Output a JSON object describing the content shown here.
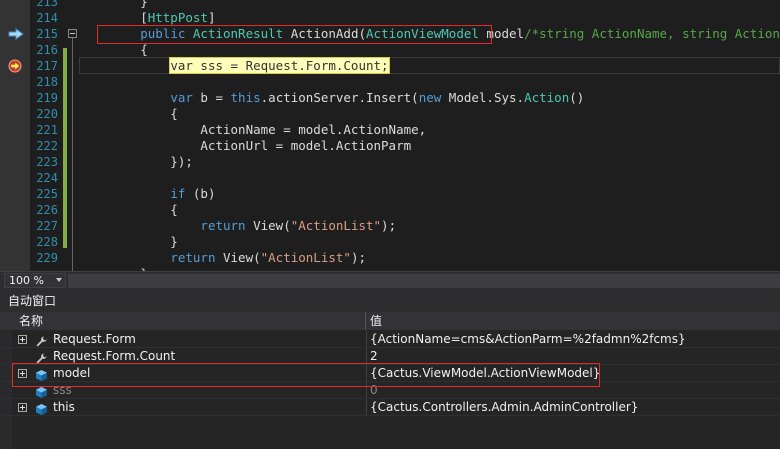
{
  "editor": {
    "lines": [
      {
        "num": "213",
        "segments": [
          {
            "t": "        }",
            "c": ""
          }
        ]
      },
      {
        "num": "214",
        "segments": [
          {
            "t": "        [",
            "c": ""
          },
          {
            "t": "HttpPost",
            "c": "ty"
          },
          {
            "t": "]",
            "c": ""
          }
        ]
      },
      {
        "num": "215",
        "segments": [
          {
            "t": "        ",
            "c": ""
          },
          {
            "t": "public ",
            "c": "kw"
          },
          {
            "t": "ActionResult",
            "c": "ty"
          },
          {
            "t": " ActionAdd(",
            "c": ""
          },
          {
            "t": "ActionViewModel",
            "c": "ty"
          },
          {
            "t": " model",
            "c": ""
          },
          {
            "t": "/*string ActionName, string ActionParm*/)",
            "c": "cm"
          }
        ]
      },
      {
        "num": "216",
        "segments": [
          {
            "t": "        {",
            "c": ""
          }
        ]
      },
      {
        "num": "217",
        "segments": [
          {
            "t": "            ",
            "c": ""
          },
          {
            "t": "var sss = Request.Form.Count;",
            "c": "exec-hl"
          }
        ]
      },
      {
        "num": "218",
        "segments": [
          {
            "t": "",
            "c": ""
          }
        ]
      },
      {
        "num": "219",
        "segments": [
          {
            "t": "            ",
            "c": ""
          },
          {
            "t": "var",
            "c": "kw"
          },
          {
            "t": " b = ",
            "c": ""
          },
          {
            "t": "this",
            "c": "kw"
          },
          {
            "t": ".actionServer.Insert(",
            "c": ""
          },
          {
            "t": "new",
            "c": "kw"
          },
          {
            "t": " Model.Sys.",
            "c": ""
          },
          {
            "t": "Action",
            "c": "ty"
          },
          {
            "t": "()",
            "c": ""
          }
        ]
      },
      {
        "num": "220",
        "segments": [
          {
            "t": "            {",
            "c": ""
          }
        ]
      },
      {
        "num": "221",
        "segments": [
          {
            "t": "                ActionName = model.ActionName,",
            "c": ""
          }
        ]
      },
      {
        "num": "222",
        "segments": [
          {
            "t": "                ActionUrl = model.ActionParm",
            "c": ""
          }
        ]
      },
      {
        "num": "223",
        "segments": [
          {
            "t": "            });",
            "c": ""
          }
        ]
      },
      {
        "num": "224",
        "segments": [
          {
            "t": "",
            "c": ""
          }
        ]
      },
      {
        "num": "225",
        "segments": [
          {
            "t": "            ",
            "c": ""
          },
          {
            "t": "if",
            "c": "kw"
          },
          {
            "t": " (b)",
            "c": ""
          }
        ]
      },
      {
        "num": "226",
        "segments": [
          {
            "t": "            {",
            "c": ""
          }
        ]
      },
      {
        "num": "227",
        "segments": [
          {
            "t": "                ",
            "c": ""
          },
          {
            "t": "return",
            "c": "kw"
          },
          {
            "t": " View(",
            "c": ""
          },
          {
            "t": "\"ActionList\"",
            "c": "st"
          },
          {
            "t": ");",
            "c": ""
          }
        ]
      },
      {
        "num": "228",
        "segments": [
          {
            "t": "            }",
            "c": ""
          }
        ]
      },
      {
        "num": "229",
        "segments": [
          {
            "t": "            ",
            "c": ""
          },
          {
            "t": "return",
            "c": "kw"
          },
          {
            "t": " View(",
            "c": ""
          },
          {
            "t": "\"ActionList\"",
            "c": "st"
          },
          {
            "t": ");",
            "c": ""
          }
        ]
      },
      {
        "num": "",
        "segments": [
          {
            "t": "        }",
            "c": ""
          }
        ]
      }
    ]
  },
  "zoom": {
    "value": "100 %"
  },
  "autos": {
    "title": "自动窗口",
    "col_name": "名称",
    "col_value": "值",
    "rows": [
      {
        "name": "Request.Form",
        "value": "{ActionName=cms&ActionParm=%2fadmn%2fcms}",
        "expandable": true,
        "icon": "wrench-icon",
        "dim": false
      },
      {
        "name": "Request.Form.Count",
        "value": "2",
        "expandable": false,
        "icon": "wrench-icon",
        "dim": false
      },
      {
        "name": "model",
        "value": "{Cactus.ViewModel.ActionViewModel}",
        "expandable": true,
        "icon": "cube-icon",
        "dim": false
      },
      {
        "name": "sss",
        "value": "0",
        "expandable": false,
        "icon": "cube-icon",
        "dim": true
      },
      {
        "name": "this",
        "value": "{Cactus.Controllers.Admin.AdminController}",
        "expandable": true,
        "icon": "cube-icon",
        "dim": false
      }
    ]
  }
}
